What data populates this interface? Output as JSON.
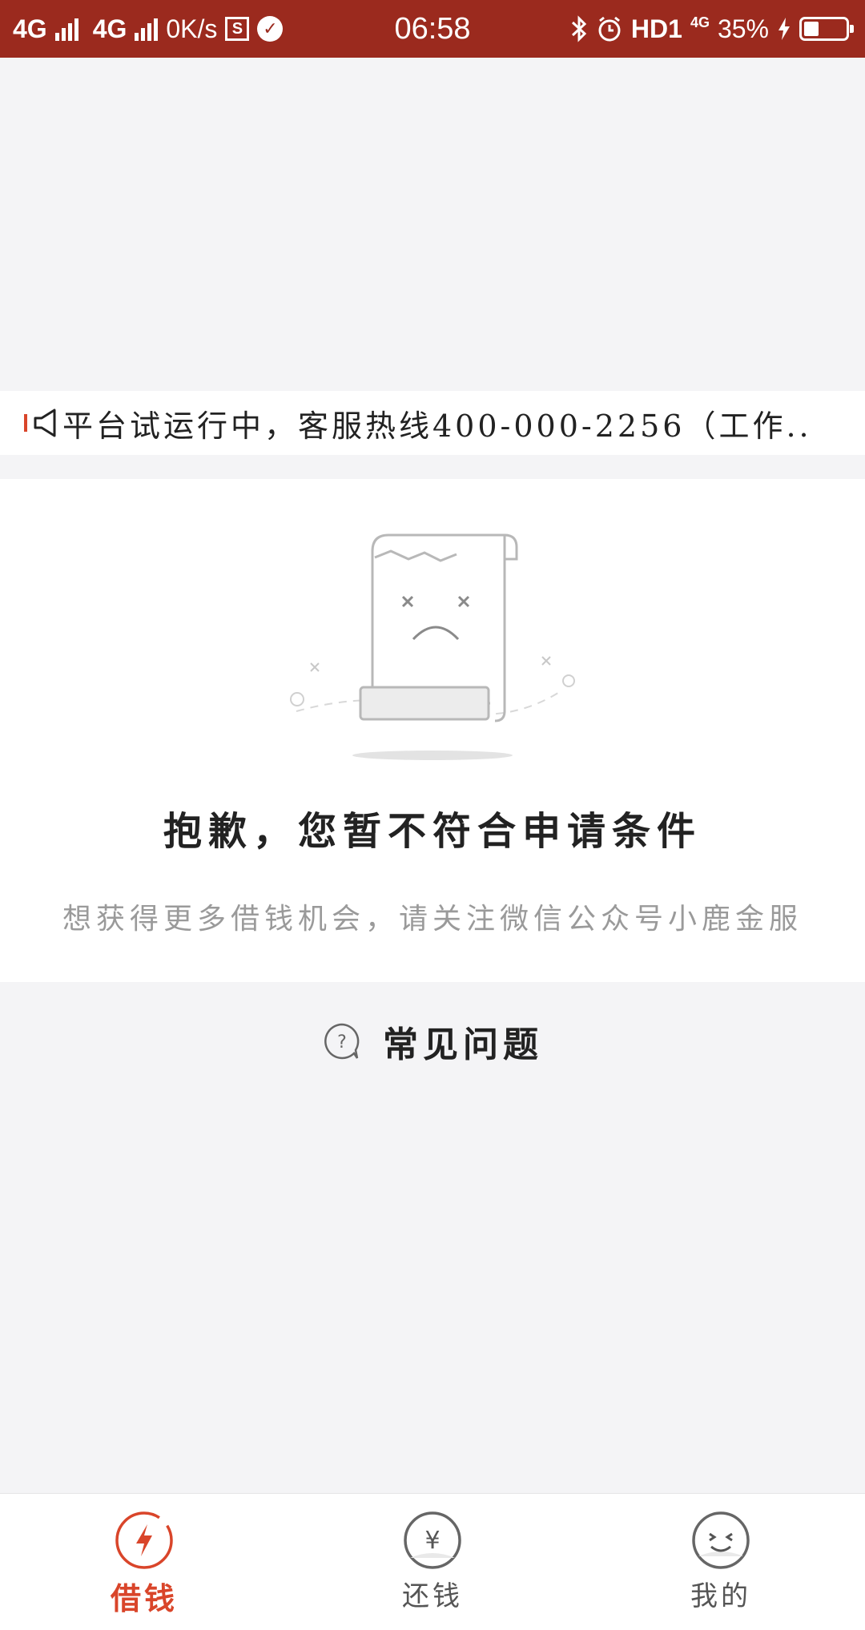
{
  "status_bar": {
    "net1": "4G",
    "net2": "4G",
    "speed": "0K/s",
    "sim_box": "S",
    "time": "06:58",
    "hd": "HD1",
    "net_small": "4G",
    "battery": "35%"
  },
  "notice": {
    "text": "平台试运行中，客服热线400-000-2256（工作.."
  },
  "result": {
    "title": "抱歉，您暂不符合申请条件",
    "subtitle": "想获得更多借钱机会，请关注微信公众号小鹿金服"
  },
  "faq": {
    "label": "常见问题"
  },
  "tabs": [
    {
      "label": "借钱",
      "icon": "lightning-icon",
      "active": true
    },
    {
      "label": "还钱",
      "icon": "yen-icon",
      "active": false
    },
    {
      "label": "我的",
      "icon": "smiley-icon",
      "active": false
    }
  ],
  "colors": {
    "status_bar": "#9b2a1e",
    "accent": "#d9452a",
    "background": "#f4f4f6"
  }
}
